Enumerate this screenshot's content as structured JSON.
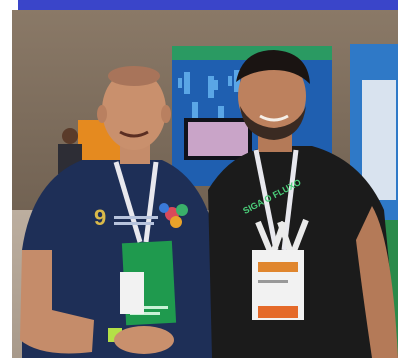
{
  "photo": {
    "badge_text_left": "9",
    "shirt_text_right": "SIGA O FLUXO"
  },
  "colors": {
    "banner": "#3a45c9",
    "wall": "#7a6a58",
    "floor": "#b7aa9c",
    "left_shirt": "#1e2f57",
    "right_shirt": "#1b1b1b",
    "lanyard_book": "#1f9a4e",
    "wristband": "#b4e047"
  }
}
